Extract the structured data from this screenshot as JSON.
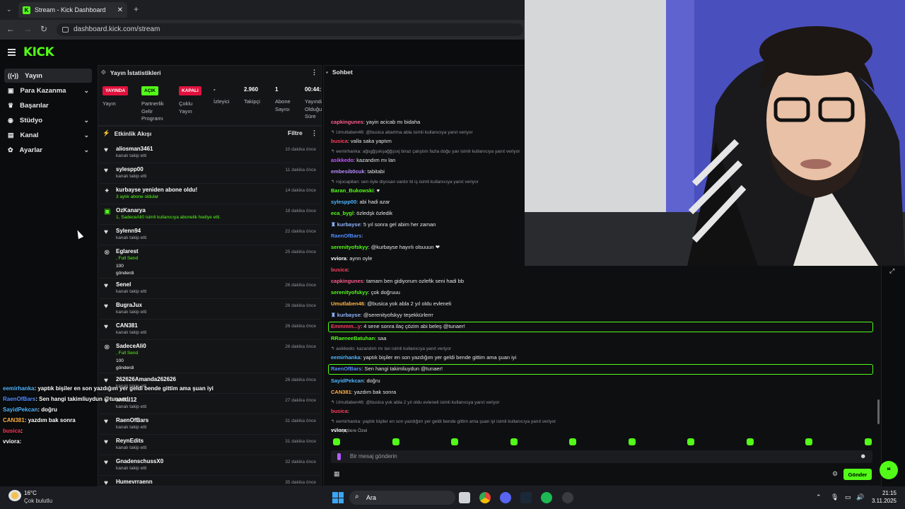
{
  "browser": {
    "tab_title": "Stream - Kick Dashboard",
    "url": "dashboard.kick.com/stream"
  },
  "sidebar": {
    "items": [
      {
        "label": "Yayın",
        "icon": "broadcast-icon"
      },
      {
        "label": "Para Kazanma",
        "icon": "money-icon"
      },
      {
        "label": "Başarılar",
        "icon": "trophy-icon"
      },
      {
        "label": "Stüdyo",
        "icon": "studio-icon"
      },
      {
        "label": "Kanal",
        "icon": "channel-icon"
      },
      {
        "label": "Ayarlar",
        "icon": "gear-icon"
      }
    ]
  },
  "stats": {
    "title": "Yayın İstatistikleri",
    "cols": [
      {
        "badge": "YAYINDA",
        "label": "Yayın"
      },
      {
        "badge": "AÇIK",
        "label": "Partnerlik Gelir Programı"
      },
      {
        "badge": "KAPALI",
        "label": "Çoklu Yayın"
      },
      {
        "value": "-",
        "label": "İzleyici"
      },
      {
        "value": "2.960",
        "label": "Takipçi"
      },
      {
        "value": "1",
        "label": "Abone Sayısı"
      },
      {
        "value": "00:44:",
        "label": "Yayında Olduğu Süre"
      }
    ]
  },
  "activity": {
    "title": "Etkinlik Akışı",
    "filter": "Filtre",
    "items": [
      {
        "name": "aliosman3461",
        "sub": "kanalı takip etti",
        "time": "10 dakika önce",
        "icon": "heart-icon"
      },
      {
        "name": "sylespp00",
        "sub": "kanalı takip etti",
        "time": "11 dakika önce",
        "icon": "heart-icon"
      },
      {
        "name": "kurbayse yeniden abone oldu!",
        "sub": "3 aylık abone oldular",
        "time": "14 dakika önce",
        "icon": "star-icon"
      },
      {
        "name": "OzKanarya",
        "sub": "1, SadeceAli0 isimli kullanıcıya abonelik hediye etti.",
        "time": "18 dakika önce",
        "icon": "gift-icon"
      },
      {
        "name": "Sylenn94",
        "sub": "kanalı takip etti",
        "time": "22 dakika önce",
        "icon": "heart-icon"
      },
      {
        "name": "Eglarest",
        "sub": ", Full Send",
        "extra": "100",
        "extra2": "gönderdi",
        "time": "25 dakika önce",
        "icon": "kicks-icon"
      },
      {
        "name": "Senel",
        "sub": "kanalı takip etti",
        "time": "26 dakika önce",
        "icon": "heart-icon"
      },
      {
        "name": "BugraJux",
        "sub": "kanalı takip etti",
        "time": "26 dakika önce",
        "icon": "heart-icon"
      },
      {
        "name": "CAN381",
        "sub": "kanalı takip etti",
        "time": "26 dakika önce",
        "icon": "heart-icon"
      },
      {
        "name": "SadeceAli0",
        "sub": ", Full Send",
        "extra": "100",
        "extra2": "gönderdi",
        "time": "26 dakika önce",
        "icon": "kicks-icon"
      },
      {
        "name": "262626Amanda262626",
        "sub": "kanalı takip etti",
        "time": "26 dakika önce",
        "icon": "heart-icon"
      },
      {
        "name": "anilal12",
        "sub": "kanalı takip etti",
        "time": "27 dakika önce",
        "icon": "heart-icon"
      },
      {
        "name": "RaenOfBars",
        "sub": "kanalı takip etti",
        "time": "31 dakika önce",
        "icon": "heart-icon"
      },
      {
        "name": "ReynEdits",
        "sub": "kanalı takip etti",
        "time": "31 dakika önce",
        "icon": "heart-icon"
      },
      {
        "name": "GnadenschussX0",
        "sub": "kanalı takip etti",
        "time": "32 dakika önce",
        "icon": "heart-icon"
      },
      {
        "name": "Humevrraenn",
        "sub": "",
        "time": "35 dakika önce",
        "icon": "heart-icon"
      }
    ]
  },
  "chat": {
    "title": "Sohbet",
    "messages": [
      {
        "type": "msg",
        "user": "capkingunes",
        "color": "#ff5a8a",
        "text": ": yayin acicab mı bidaha"
      },
      {
        "type": "rep",
        "text": "↰ Umutlaben46: @busica abartma abla isimli kullanıcıya yanıt veriyor"
      },
      {
        "type": "msg",
        "user": "busica",
        "color": "#ff3b5c",
        "text": ": valla saka yaptım"
      },
      {
        "type": "rep",
        "text": "↰ eemirhanka: ağsgğşskşağğşsxj biraz çalıştım fazla doğu yav isimli kullanıcıya yanıt veriyor"
      },
      {
        "type": "msg",
        "user": "asikkedo",
        "color": "#c35bff",
        "text": ": kazandım mı lan"
      },
      {
        "type": "msg",
        "user": "embesib0cuk",
        "color": "#b68cff",
        "text": ": tabitabi"
      },
      {
        "type": "rep",
        "text": "↰ rojocapitan: sen öyle diyosan vardır bi iş isimli kullanıcıya yanıt veriyor"
      },
      {
        "type": "msg",
        "user": "Baran_Bukowski",
        "color": "#53fc18",
        "text": ": ♥"
      },
      {
        "type": "msg",
        "user": "sylespp00",
        "color": "#4fb6ff",
        "text": ": abi hadi azar"
      },
      {
        "type": "msg",
        "user": "eca_bygl",
        "color": "#53fc18",
        "text": ": özledşk özledik"
      },
      {
        "type": "msg",
        "user": "♜ kurbayse",
        "color": "#8fb4ff",
        "text": ": 5 yıl sonra gel abim her zaman"
      },
      {
        "type": "msg",
        "user": "RaenOfBars",
        "color": "#4f8cff",
        "text": ":"
      },
      {
        "type": "msg",
        "user": "serenityofskyy",
        "color": "#53fc18",
        "text": ": @kurbayse hayırlı olsuuun ❤"
      },
      {
        "type": "msg",
        "user": "vviora",
        "color": "#ffffff",
        "text": ": aynn oyle"
      },
      {
        "type": "msg",
        "user": "busica",
        "color": "#ff3b5c",
        "text": ":"
      },
      {
        "type": "msg",
        "user": "capkingunes",
        "color": "#ff5a8a",
        "text": ": tamam ben gidiyorum ozlefik seni hadi bb"
      },
      {
        "type": "msg",
        "user": "serenityofskyy",
        "color": "#53fc18",
        "text": ": çok doğruuu"
      },
      {
        "type": "msg",
        "user": "Umutlaben46",
        "color": "#ffb347",
        "text": ": @busica yok abla 2 yıl oldu evleneli"
      },
      {
        "type": "msg",
        "user": "♜ kurbayse",
        "color": "#8fb4ff",
        "text": ": @serenityofskyy teşekkürlerrr"
      },
      {
        "type": "hl",
        "user": "Emmmm...y",
        "color": "#ff3b5c",
        "text": ": 4 sene sonra ilaç çözim abi beleş @tunaer!"
      },
      {
        "type": "msg",
        "user": "RRaeneeBatuhan",
        "color": "#53fc18",
        "text": ": saa"
      },
      {
        "type": "rep",
        "text": "↰ asikkedo: kazandım mı lan isimli kullanıcıya yanıt veriyor"
      },
      {
        "type": "msg",
        "user": "eemirhanka",
        "color": "#4fb6ff",
        "text": ": yaptık bişiler en son yazdığım yer geldi bende gittim ama şuan iyi"
      },
      {
        "type": "hl",
        "user": "RaenOfBars",
        "color": "#4f8cff",
        "text": ": Sen hangi takimliuydun @tunaer!"
      },
      {
        "type": "msg",
        "user": "SayidPekcan",
        "color": "#4fb6ff",
        "text": ": doğru"
      },
      {
        "type": "msg",
        "user": "CAN381",
        "color": "#ffb347",
        "text": ": yazdım bak sonra"
      },
      {
        "type": "rep",
        "text": "↰ Umutlaben46: @busica yok abla 2 yıl oldu evleneli isimli kullanıcıya yanıt veriyor"
      },
      {
        "type": "msg",
        "user": "busica",
        "color": "#ff3b5c",
        "text": ":"
      },
      {
        "type": "rep",
        "text": "↰ eemirhanka: yaptık bişiler en son yazdığım yer geldi bende gittim ama şuan iyi isimli kullanıcıya yanıt veriyor"
      },
      {
        "type": "msg",
        "user": "vviora",
        "color": "#ffffff",
        "text": ":"
      }
    ],
    "followers_label": "♥ Takipçilere Özel",
    "input_placeholder": "Bir mesaj gönderin",
    "send_label": "Gönder"
  },
  "overlay": [
    {
      "user": "eemirhanka",
      "color": "#4fb6ff",
      "text": ": yaptık bişiler en son yazdığım yer geldi bende gittim ama şuan iyi"
    },
    {
      "user": "RaenOfBars",
      "color": "#4f8cff",
      "text": ": Sen hangi takimliuydun @tunaer!"
    },
    {
      "user": "SayidPekcan",
      "color": "#4fb6ff",
      "text": ": doğru"
    },
    {
      "user": "CAN381",
      "color": "#ffb347",
      "text": ": yazdım bak sonra"
    },
    {
      "user": "busica",
      "color": "#ff3b5c",
      "text": ":"
    },
    {
      "user": "vviora",
      "color": "#ffffff",
      "text": ":"
    }
  ],
  "taskbar": {
    "weather_temp": "16°C",
    "weather_desc": "Çok bulutlu",
    "search": "Ara",
    "time": "21:15",
    "date": "3.11.2025"
  },
  "colors": {
    "accent": "#53fc18",
    "live": "#e0123d"
  }
}
